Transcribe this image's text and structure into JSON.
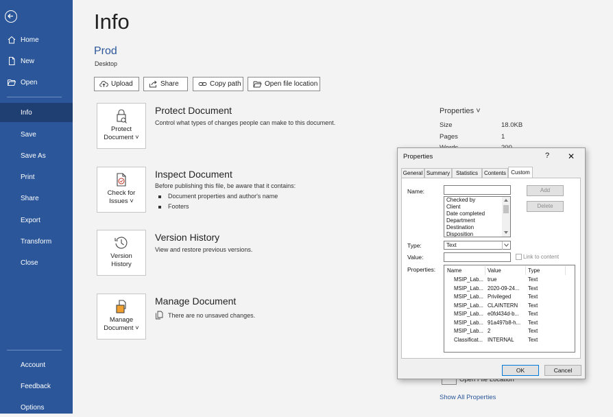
{
  "sidebar": {
    "items": [
      {
        "label": "Home"
      },
      {
        "label": "New"
      },
      {
        "label": "Open"
      },
      {
        "label": "Info"
      },
      {
        "label": "Save"
      },
      {
        "label": "Save As"
      },
      {
        "label": "Print"
      },
      {
        "label": "Share"
      },
      {
        "label": "Export"
      },
      {
        "label": "Transform"
      },
      {
        "label": "Close"
      },
      {
        "label": "Account"
      },
      {
        "label": "Feedback"
      },
      {
        "label": "Options"
      }
    ]
  },
  "page": {
    "title": "Info",
    "doc_name": "Prod",
    "doc_location": "Desktop"
  },
  "actions": {
    "upload": "Upload",
    "share": "Share",
    "copy_path": "Copy path",
    "open_location": "Open file location"
  },
  "sections": {
    "protect": {
      "tile_line1": "Protect",
      "tile_line2": "Document ˅",
      "heading": "Protect Document",
      "desc": "Control what types of changes people can make to this document."
    },
    "inspect": {
      "tile_line1": "Check for",
      "tile_line2": "Issues ˅",
      "heading": "Inspect Document",
      "desc": "Before publishing this file, be aware that it contains:",
      "bullets": [
        "Document properties and author's name",
        "Footers"
      ]
    },
    "version": {
      "tile_line1": "Version",
      "tile_line2": "History",
      "heading": "Version History",
      "desc": "View and restore previous versions."
    },
    "manage": {
      "tile_line1": "Manage",
      "tile_line2": "Document ˅",
      "heading": "Manage Document",
      "desc": "There are no unsaved changes."
    }
  },
  "properties": {
    "heading": "Properties ˅",
    "size_label": "Size",
    "size_value": "18.0KB",
    "pages_label": "Pages",
    "pages_value": "1",
    "words_label": "Words",
    "words_value": "200",
    "show_all": "Show All Properties",
    "open_file_location": "Open File Location"
  },
  "dialog": {
    "title": "Properties",
    "help": "?",
    "close": "✕",
    "tabs": [
      "General",
      "Summary",
      "Statistics",
      "Contents",
      "Custom"
    ],
    "name_label": "Name:",
    "name_list": [
      "Checked by",
      "Client",
      "Date completed",
      "Department",
      "Destination",
      "Disposition"
    ],
    "add_label": "Add",
    "delete_label": "Delete",
    "type_label": "Type:",
    "type_value": "Text",
    "value_label": "Value:",
    "value_value": "",
    "link_label": "Link to content",
    "properties_label": "Properties:",
    "columns": [
      "Name",
      "Value",
      "Type"
    ],
    "rows": [
      {
        "name": "MSIP_Lab...",
        "value": "true",
        "type": "Text"
      },
      {
        "name": "MSIP_Lab...",
        "value": "2020-09-24...",
        "type": "Text"
      },
      {
        "name": "MSIP_Lab...",
        "value": "Privileged",
        "type": "Text"
      },
      {
        "name": "MSIP_Lab...",
        "value": "CLAINTERN",
        "type": "Text"
      },
      {
        "name": "MSIP_Lab...",
        "value": "e0fd434d-b...",
        "type": "Text"
      },
      {
        "name": "MSIP_Lab...",
        "value": "91a497b8-h...",
        "type": "Text"
      },
      {
        "name": "MSIP_Lab...",
        "value": "2",
        "type": "Text"
      },
      {
        "name": "Classificat...",
        "value": "INTERNAL",
        "type": "Text"
      }
    ],
    "ok": "OK",
    "cancel": "Cancel"
  }
}
